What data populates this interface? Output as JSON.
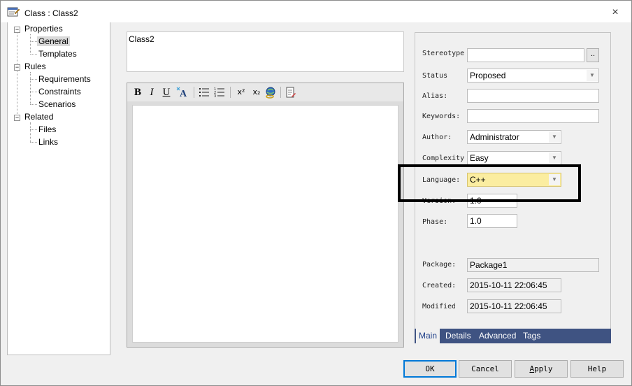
{
  "window": {
    "title": "Class : Class2",
    "close_label": "×"
  },
  "tree": {
    "items": [
      {
        "label": "Properties"
      },
      {
        "label": "General"
      },
      {
        "label": "Templates"
      },
      {
        "label": "Rules"
      },
      {
        "label": "Requirements"
      },
      {
        "label": "Constraints"
      },
      {
        "label": "Scenarios"
      },
      {
        "label": "Related"
      },
      {
        "label": "Files"
      },
      {
        "label": "Links"
      }
    ],
    "selected": "General"
  },
  "name": {
    "value": "Class2"
  },
  "notes_toolbar": {
    "bold": "B",
    "italic": "I",
    "underline": "U",
    "superscript": "x²",
    "subscript": "x₂"
  },
  "properties": {
    "stereotype": {
      "label": "Stereotype",
      "value": "",
      "button": ".."
    },
    "status": {
      "label": "Status",
      "value": "Proposed"
    },
    "alias": {
      "label": "Alias:",
      "value": ""
    },
    "keywords": {
      "label": "Keywords:",
      "value": ""
    },
    "author": {
      "label": "Author:",
      "value": "Administrator"
    },
    "complexity": {
      "label": "Complexity",
      "value": "Easy"
    },
    "language": {
      "label": "Language:",
      "value": "C++"
    },
    "version": {
      "label": "Version:",
      "value": "1.0"
    },
    "phase": {
      "label": "Phase:",
      "value": "1.0"
    },
    "package": {
      "label": "Package:",
      "value": "Package1"
    },
    "created": {
      "label": "Created:",
      "value": "2015-10-11 22:06:45"
    },
    "modified": {
      "label": "Modified",
      "value": "2015-10-11 22:06:45"
    }
  },
  "tabs": [
    {
      "label": "Main",
      "active": true
    },
    {
      "label": "Details"
    },
    {
      "label": "Advanced"
    },
    {
      "label": "Tags"
    }
  ],
  "buttons": {
    "ok": "OK",
    "cancel": "Cancel",
    "apply_u": "A",
    "apply_rest": "pply",
    "help": "Help"
  },
  "colors": {
    "tabs_bar": "#3f5382",
    "language_highlight": "#fbeda0",
    "default_button_border": "#0078d7"
  }
}
